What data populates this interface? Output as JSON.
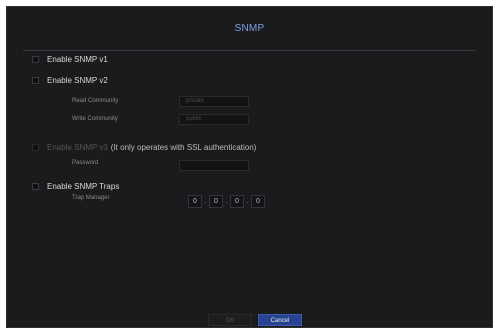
{
  "dialog": {
    "title": "SNMP"
  },
  "snmp_v1": {
    "label": "Enable SNMP v1",
    "checked": false
  },
  "snmp_v2": {
    "label": "Enable SNMP v2",
    "checked": false,
    "read_community_label": "Read Community",
    "read_community_value": "private",
    "write_community_label": "Write Community",
    "write_community_value": "public"
  },
  "snmp_v3": {
    "label": "Enable SNMP v3",
    "note": "(It only operates with SSL authentication)",
    "enabled": false,
    "password_label": "Password",
    "password_value": ""
  },
  "snmp_traps": {
    "label": "Enable SNMP Traps",
    "checked": false,
    "trap_manager_label": "Trap Manager",
    "trap_manager_octets": [
      "0",
      "0",
      "0",
      "0"
    ]
  },
  "buttons": {
    "ok": "OK",
    "cancel": "Cancel"
  },
  "colors": {
    "background": "#1b1b1d",
    "title": "#7aa2e0",
    "cancel_button": "#26448e",
    "text": "#d8d8d8",
    "disabled_text": "#525254"
  }
}
